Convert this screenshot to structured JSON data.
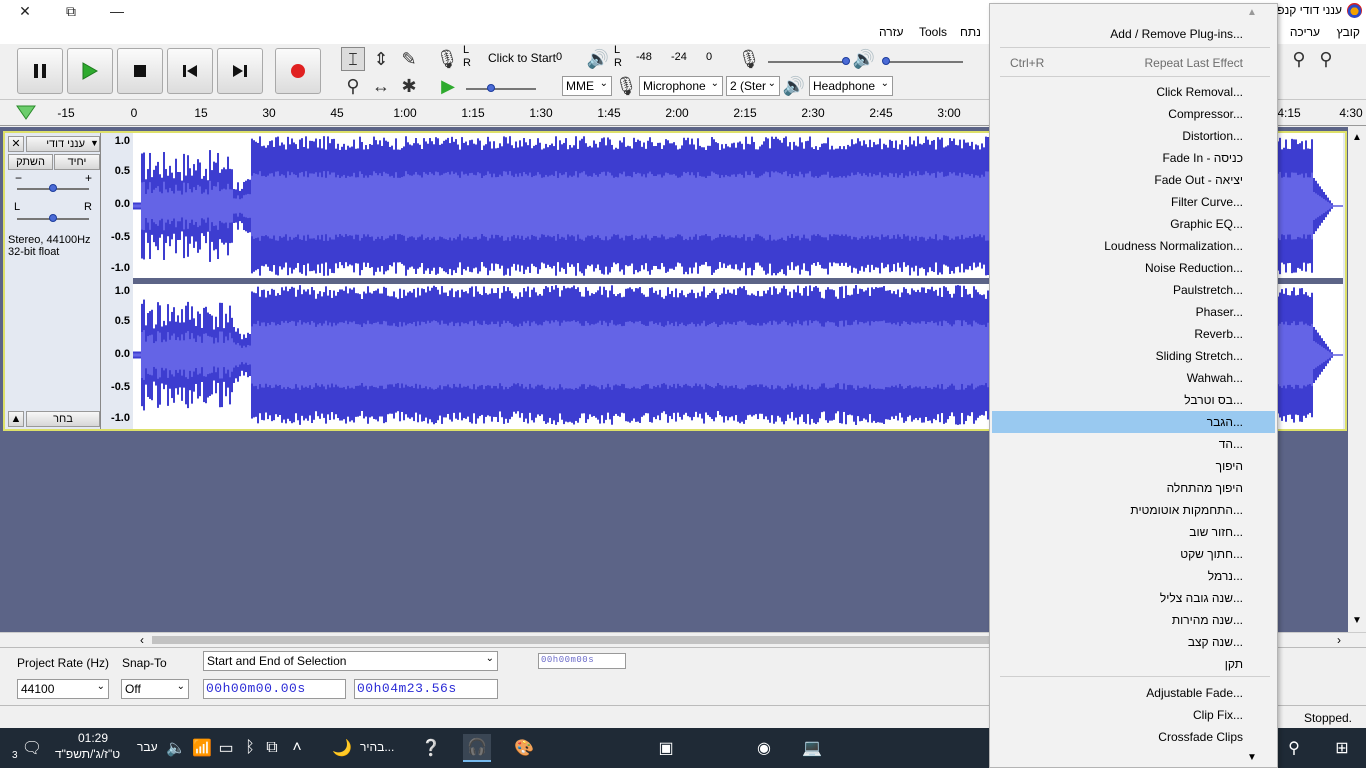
{
  "window": {
    "title": "ענני דודי קנפ",
    "close": "✕",
    "restore": "⧉",
    "minimize": "—"
  },
  "menubar": {
    "items": [
      "קובץ",
      "עריכה",
      "נתח",
      "Tools",
      "עזרה"
    ]
  },
  "transport": {
    "pause": "pause-icon",
    "play": "play-icon",
    "stop": "stop-icon",
    "skip_start": "skip-start-icon",
    "skip_end": "skip-end-icon",
    "record": "record-icon",
    "record_color": "#e02020",
    "play_color": "#2eaa2e"
  },
  "meters": {
    "record_hint": "Click to Start",
    "lr_top": "L",
    "lr_bottom": "R",
    "zero": "0",
    "marks": [
      "-48",
      "-24",
      "0"
    ]
  },
  "devices": {
    "host": "MME",
    "input": "Microphone",
    "channels": "2 (Ster",
    "output": "Headphone"
  },
  "ruler": {
    "ticks": [
      "-15",
      "0",
      "15",
      "30",
      "45",
      "1:00",
      "1:15",
      "1:30",
      "1:45",
      "2:00",
      "2:15",
      "2:30",
      "2:45",
      "3:00",
      "4:15",
      "4:30"
    ]
  },
  "track": {
    "name": "ענני דודי קנפ",
    "mute": "השתק",
    "solo": "יחיד",
    "gain_minus": "−",
    "gain_plus": "+",
    "pan_left": "L",
    "pan_right": "R",
    "info_line1": "Stereo, 44100Hz",
    "info_line2": "32-bit float",
    "select": "בחר",
    "scale": [
      "1.0",
      "0.5",
      "0.0",
      "-0.5",
      "-1.0"
    ],
    "wave_color": "#3d3dd0",
    "wave_rms_color": "#6464e6"
  },
  "selection": {
    "rate_label": "Project Rate (Hz)",
    "rate_value": "44100",
    "snap_label": "Snap-To",
    "snap_value": "Off",
    "mode": "Start and End of Selection",
    "start": "00h00m00.00s",
    "end": "00h04m23.56s",
    "position": "00h00m00s"
  },
  "status": {
    "text": "Stopped."
  },
  "taskbar": {
    "time": "01:29",
    "date": "ט\"ז/ג'/תשפ\"ד",
    "lang": "עבר",
    "notif_count": "3",
    "app_label": "בהיר..."
  },
  "effect_menu": {
    "items": [
      {
        "label": "Add / Remove Plug-ins...",
        "shortcut": ""
      },
      {
        "label": "Repeat Last Effect",
        "shortcut": "Ctrl+R"
      },
      {
        "label": "Click Removal...",
        "shortcut": ""
      },
      {
        "label": "Compressor...",
        "shortcut": ""
      },
      {
        "label": "Distortion...",
        "shortcut": ""
      },
      {
        "label": "Fade In - כניסה",
        "shortcut": ""
      },
      {
        "label": "Fade Out - יציאה",
        "shortcut": ""
      },
      {
        "label": "Filter Curve...",
        "shortcut": ""
      },
      {
        "label": "Graphic EQ...",
        "shortcut": ""
      },
      {
        "label": "Loudness Normalization...",
        "shortcut": ""
      },
      {
        "label": "Noise Reduction...",
        "shortcut": ""
      },
      {
        "label": "Paulstretch...",
        "shortcut": ""
      },
      {
        "label": "Phaser...",
        "shortcut": ""
      },
      {
        "label": "Reverb...",
        "shortcut": ""
      },
      {
        "label": "Sliding Stretch...",
        "shortcut": ""
      },
      {
        "label": "Wahwah...",
        "shortcut": ""
      },
      {
        "label": "בס וטרבל...",
        "shortcut": ""
      },
      {
        "label": "הגבר...",
        "shortcut": ""
      },
      {
        "label": "הד...",
        "shortcut": ""
      },
      {
        "label": "היפוך",
        "shortcut": ""
      },
      {
        "label": "היפוך מהתחלה",
        "shortcut": ""
      },
      {
        "label": "התחמקות אוטומטית...",
        "shortcut": ""
      },
      {
        "label": "חזור שוב...",
        "shortcut": ""
      },
      {
        "label": "חתוך שקט...",
        "shortcut": ""
      },
      {
        "label": "נרמל...",
        "shortcut": ""
      },
      {
        "label": "שנה גובה צליל...",
        "shortcut": ""
      },
      {
        "label": "שנה מהירות...",
        "shortcut": ""
      },
      {
        "label": "שנה קצב...",
        "shortcut": ""
      },
      {
        "label": "תקן",
        "shortcut": ""
      },
      {
        "label": "Adjustable Fade...",
        "shortcut": ""
      },
      {
        "label": "Clip Fix...",
        "shortcut": ""
      },
      {
        "label": "Crossfade Clips",
        "shortcut": ""
      }
    ],
    "highlighted": "הגבר...",
    "highlight_color": "#99c9f0"
  }
}
